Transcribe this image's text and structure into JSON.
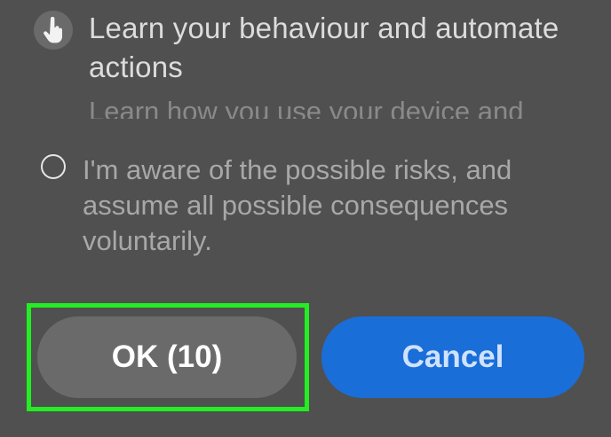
{
  "permission": {
    "icon": "tap-hand-icon",
    "title": "Learn your behaviour and automate actions",
    "description": "Learn how you use your device and"
  },
  "consent": {
    "checked": false,
    "text": "I'm aware of the possible risks, and assume all possible consequences voluntarily."
  },
  "buttons": {
    "ok_label": "OK (10)",
    "cancel_label": "Cancel"
  },
  "colors": {
    "background": "#505050",
    "ok_button": "#6a6a6a",
    "cancel_button": "#1a6ed8",
    "highlight": "#22ee22"
  }
}
